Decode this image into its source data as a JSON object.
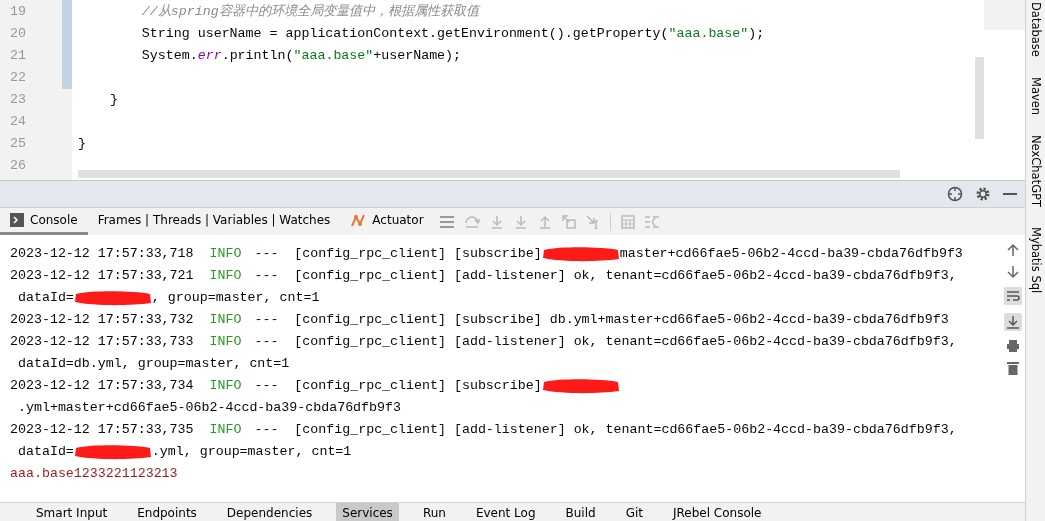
{
  "editor": {
    "lines": [
      {
        "number": "19",
        "segments": [
          {
            "kind": "comment",
            "text": "        //从spring容器中的环境全局变量值中，根据属性获取值"
          }
        ]
      },
      {
        "number": "20",
        "segments": [
          {
            "kind": "plain",
            "text": "        String userName = applicationContext.getEnvironment().getProperty("
          },
          {
            "kind": "string",
            "text": "\"aaa.base\""
          },
          {
            "kind": "plain",
            "text": ");"
          }
        ]
      },
      {
        "number": "21",
        "segments": [
          {
            "kind": "plain",
            "text": "        System."
          },
          {
            "kind": "field",
            "text": "err"
          },
          {
            "kind": "plain",
            "text": ".println("
          },
          {
            "kind": "string",
            "text": "\"aaa.base\""
          },
          {
            "kind": "plain",
            "text": "+userName);"
          }
        ]
      },
      {
        "number": "22"
      },
      {
        "number": "23",
        "segments": [
          {
            "kind": "plain",
            "text": "    }"
          }
        ]
      },
      {
        "number": "24"
      },
      {
        "number": "25",
        "segments": [
          {
            "kind": "plain",
            "text": "}"
          }
        ]
      },
      {
        "number": "26"
      }
    ]
  },
  "right_sidebar": {
    "items": [
      "Database",
      "Maven",
      "NexChatGPT",
      "Mybatis Sql"
    ]
  },
  "tool_window": {
    "tabs": [
      {
        "label": "Console",
        "selected": true
      },
      {
        "label": "Frames | Threads | Variables | Watches",
        "selected": false
      },
      {
        "label": "Actuator",
        "selected": false
      }
    ],
    "console": {
      "lines": [
        {
          "segments": [
            {
              "kind": "time",
              "text": "2023-12-12 17:57:33,718"
            },
            {
              "kind": "level",
              "text": "INFO"
            },
            {
              "kind": "text",
              "text": "---  [config_rpc_client] [subscribe]"
            },
            {
              "kind": "redaction"
            },
            {
              "kind": "text",
              "text": "master+cd66fae5-06b2-4ccd-ba39-cbda76dfb9f3"
            }
          ]
        },
        {
          "segments": [
            {
              "kind": "time",
              "text": "2023-12-12 17:57:33,721"
            },
            {
              "kind": "level",
              "text": "INFO"
            },
            {
              "kind": "text",
              "text": "---  [config_rpc_client] [add-listener] ok, tenant=cd66fae5-06b2-4ccd-ba39-cbda76dfb9f3,"
            }
          ]
        },
        {
          "segments": [
            {
              "kind": "text",
              "text": " dataId="
            },
            {
              "kind": "redaction"
            },
            {
              "kind": "text",
              "text": ", group=master, cnt=1"
            }
          ]
        },
        {
          "segments": [
            {
              "kind": "time",
              "text": "2023-12-12 17:57:33,732"
            },
            {
              "kind": "level",
              "text": "INFO"
            },
            {
              "kind": "text",
              "text": "---  [config_rpc_client] [subscribe] db.yml+master+cd66fae5-06b2-4ccd-ba39-cbda76dfb9f3"
            }
          ]
        },
        {
          "segments": [
            {
              "kind": "time",
              "text": "2023-12-12 17:57:33,733"
            },
            {
              "kind": "level",
              "text": "INFO"
            },
            {
              "kind": "text",
              "text": "---  [config_rpc_client] [add-listener] ok, tenant=cd66fae5-06b2-4ccd-ba39-cbda76dfb9f3,"
            }
          ]
        },
        {
          "segments": [
            {
              "kind": "text",
              "text": " dataId=db.yml, group=master, cnt=1"
            }
          ]
        },
        {
          "segments": [
            {
              "kind": "time",
              "text": "2023-12-12 17:57:33,734"
            },
            {
              "kind": "level",
              "text": "INFO"
            },
            {
              "kind": "text",
              "text": "---  [config_rpc_client] [subscribe]"
            },
            {
              "kind": "redaction"
            }
          ]
        },
        {
          "segments": [
            {
              "kind": "text",
              "text": " .yml+master+cd66fae5-06b2-4ccd-ba39-cbda76dfb9f3"
            }
          ]
        },
        {
          "segments": [
            {
              "kind": "time",
              "text": "2023-12-12 17:57:33,735"
            },
            {
              "kind": "level",
              "text": "INFO"
            },
            {
              "kind": "text",
              "text": "---  [config_rpc_client] [add-listener] ok, tenant=cd66fae5-06b2-4ccd-ba39-cbda76dfb9f3,"
            }
          ]
        },
        {
          "segments": [
            {
              "kind": "text",
              "text": " dataId="
            },
            {
              "kind": "redaction"
            },
            {
              "kind": "text",
              "text": ".yml, group=master, cnt=1"
            }
          ]
        },
        {
          "segments": [
            {
              "kind": "output",
              "text": "aaa.base1233221123213"
            }
          ]
        }
      ]
    }
  },
  "bottom_bar": {
    "items": [
      {
        "label": "Smart Input",
        "selected": false
      },
      {
        "label": "Endpoints",
        "selected": false
      },
      {
        "label": "Dependencies",
        "selected": false
      },
      {
        "label": "Services",
        "selected": true
      },
      {
        "label": "Run",
        "selected": false
      },
      {
        "label": "Event Log",
        "selected": false
      },
      {
        "label": "Build",
        "selected": false
      },
      {
        "label": "Git",
        "selected": false
      },
      {
        "label": "JRebel Console",
        "selected": false
      }
    ]
  }
}
